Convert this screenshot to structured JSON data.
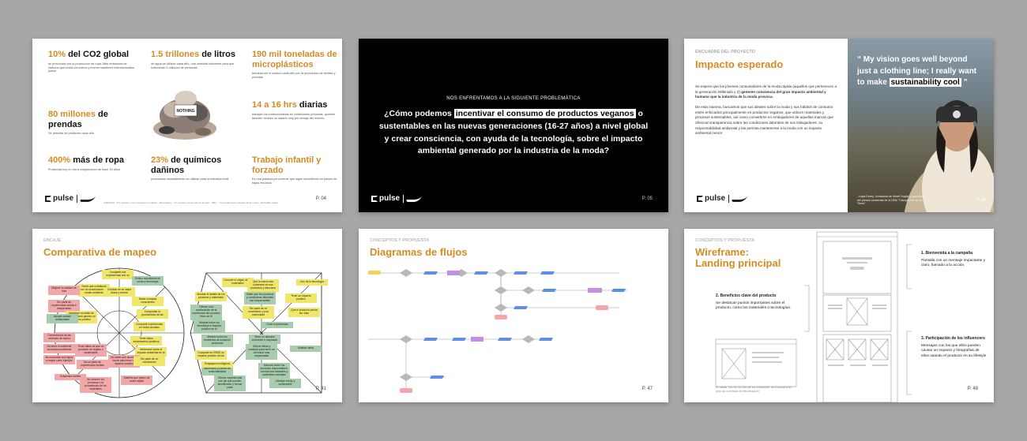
{
  "slide1": {
    "stats": [
      {
        "hl": "10%",
        "rest": " del CO2 global",
        "desc": "se provocado por la producción de ropa. Más emisiones de carbono que todos los vuelos y envíos marítimos internacionales juntos"
      },
      {
        "hl": "1.5 trillones",
        "rest": " de litros",
        "desc": "de agua se utilizan cada año, una cantidad suficiente para que sobrevivan 5 millones de personas"
      },
      {
        "hl": "190 mil toneladas de microplásticos",
        "rest": "",
        "desc": "terminan en el océano cada año por la producción de textiles y prendas"
      },
      {
        "hl": "80 millones",
        "rest": " de prendas",
        "desc": "Se prendas se producen cada año"
      },
      {
        "hl": "14 a 16 hrs",
        "rest": " diarias",
        "desc": "trabajan los confeccionistas en condiciones precarias, quienes también reciben un salario muy por debajo del mínimo"
      },
      {
        "hl": "400%",
        "rest": " más de ropa",
        "desc": "Producida hoy en día a comparación de hace 20 años"
      },
      {
        "hl": "23%",
        "rest": " de químicos dañinos",
        "desc": "producidos mundialmente se utilizan para la industria textil"
      },
      {
        "hl": "Trabajo infantil y forzado",
        "rest": "",
        "desc": "Es una práctica percurrente que sigue sucediendo en países de bajos recursos"
      }
    ],
    "sources": "FUENTES: \"The Fashion, Inc's contrast is on fatter\" - Bloomberg · \"Un vestido cuesta más de la vida\" - BBC · \"Cómo ahorra la industria de la moda\" - Bolsa/Ms. Nette",
    "page": "P. 04",
    "brand": "pulse"
  },
  "slide2": {
    "kicker": "NOS ENFRENTAMOS A LA SIGUIENTE PROBLEMÁTICA",
    "q_a": "¿Cómo podemos ",
    "q_hl": "incentivar el consumo de productos veganos",
    "q_b": " o sustentables en las nuevas generaciones (16-27 años) a nivel global y crear consciencia, con ayuda de la tecnología, sobre el impacto ambiental generado por la industria de la moda?",
    "page": "P. 05",
    "brand": "pulse"
  },
  "slide3": {
    "kicker": "ENCUADRE DEL PROYECTO",
    "title": "Impacto esperado",
    "p1a": "Se espera que los jóvenes consumidores de la moda rápida (aquellos que pertenecen a la generación Millenials y Z) ",
    "p1b": "generen conciencia del gran impacto ambiental y humano que la industria de la moda provoca.",
    "p2": "De esta manera, buscamos que sus ideales sobre la moda y sus hábitos de consumo estén enfocados principalmente en productos veganos, que utilicen materiales y procesos sustentables, así como convertirse en embajadores de aquellas marcas que ofrezcan transparencia sobre las condiciones laborales de sus trabajadores, su responsabilidad ambiental y las permita mantenerse a la moda con un impacto ambiental menor.",
    "quote_a": "“ My vision goes well beyond just a clothing line; I really want to make ",
    "quote_hl": "sustainability cool",
    "quote_b": " ”",
    "caption": "- Kaya Dorey, fundadora de Novel Supply y ganadora del premio ambiental de la ONU \"Campeones de la Tierra\"",
    "page": "P. 06",
    "brand": "pulse"
  },
  "slide4": {
    "kicker": "ENCAJE",
    "title": "Comparativa de mapeo",
    "left_notes": [
      {
        "t": "Compartir sus experiencias con su",
        "c": "y"
      },
      {
        "t": "Sentir que contribuye con la conservación del medio ambiente",
        "c": "y"
      },
      {
        "t": "Exhibir actualizado en moda y tecnología",
        "c": "g"
      },
      {
        "t": "Cuidado de su salud física y mental",
        "c": "y"
      },
      {
        "t": "Mejorar su calidad de vida",
        "c": "r"
      },
      {
        "t": "Ser parte de experiencias únicas e inesperadas",
        "c": "r"
      },
      {
        "t": "Hacer compras conscientes",
        "c": "y"
      },
      {
        "t": "Mantener su estilo de vida mientras genera un impacto positivo",
        "c": "y"
      },
      {
        "t": "Comprobar la procedencia de las",
        "c": "y"
      },
      {
        "t": "Apoyar causas ambientales",
        "c": "g"
      },
      {
        "t": "Compartir experiencias en redes sociales",
        "c": "y"
      },
      {
        "t": "Conveniencia de las acciones de marca",
        "c": "r"
      },
      {
        "t": "Tener datos fundamentos positivos",
        "c": "y"
      },
      {
        "t": "No tener el suficiente económica suficiente",
        "c": "r"
      },
      {
        "t": "Tener datos de que un producto es vegano o sustentable",
        "c": "r"
      },
      {
        "t": "Informarse sobre el impacto ambiental de la",
        "c": "y"
      },
      {
        "t": "No encontrar una figura a seguir como ejemplo",
        "c": "r"
      },
      {
        "t": "No se parte de experiencias inútiles",
        "c": "r"
      },
      {
        "t": "No saber qué acciones tomar para tener un impacto positivo",
        "c": "r"
      },
      {
        "t": "Ser parte de un movimiento",
        "c": "y"
      },
      {
        "t": "Existencia inútiles",
        "c": "r"
      },
      {
        "t": "No conocer los procesos o la procedencia de los materiales",
        "c": "r"
      },
      {
        "t": "Diseños que pasen de moda rápido",
        "c": "r"
      }
    ],
    "right_notes": [
      {
        "t": "Conocer el origen de los materiales",
        "c": "y"
      },
      {
        "t": "Que la marca sea coherente en sus productos y discursos",
        "c": "y"
      },
      {
        "t": "Uso de la tecnología",
        "c": "y"
      },
      {
        "t": "Mostrar el detalle de los procesos y materiales",
        "c": "y"
      },
      {
        "t": "Saber que los procesos y condiciones laborales son responsables",
        "c": "g"
      },
      {
        "t": "Tener un impacto positivo",
        "c": "y"
      },
      {
        "t": "Ofrecer una continuación de la experiencia del producto físico en el",
        "c": "g"
      },
      {
        "t": "Ser parte de un movimiento y una comunidad",
        "c": "y"
      },
      {
        "t": "Que el producto pueda ser visto",
        "c": "y"
      },
      {
        "t": "Crear experiencias",
        "c": "g"
      },
      {
        "t": "Mostrar todos los beneficios el impacto positivo en el",
        "c": "g"
      },
      {
        "t": "Mostrar todos los beneficios de consumir productos",
        "c": "g"
      },
      {
        "t": "Tener un discurso coherente e inspirador",
        "c": "g"
      },
      {
        "t": "Ofrecer ideas y consejos para tener un consumo más responsable",
        "c": "g"
      },
      {
        "t": "Mostrar cifras",
        "c": "g"
      },
      {
        "t": "Compartir en RRSS su impacto positivo de las",
        "c": "y"
      },
      {
        "t": "Colaborar con influencers y líderes de sustentabilidad",
        "c": "g"
      },
      {
        "t": "Informar sobre los procesos responsables, condiciones laborales y materiales naturales",
        "c": "g"
      },
      {
        "t": "Empaques ecológicos",
        "c": "y"
      },
      {
        "t": "Ofrecer experiencias con las que pueden identificarse y formar parte",
        "c": "g"
      },
      {
        "t": "Lifestyle trendy y sustentable",
        "c": "g"
      }
    ],
    "page": "P. 41"
  },
  "slide5": {
    "kicker": "CONCEPTOS Y PROPUESTA",
    "title": "Diagramas de flujos",
    "page": "P. 47"
  },
  "slide6": {
    "kicker": "CONCEPTOS Y PROPUESTA",
    "title": "Wireframe: Landing principal",
    "items": [
      {
        "t": "1. Bienvenida a la campaña",
        "d": "Pantalla con un mensaje impactante y claro, llamado a la acción."
      },
      {
        "t": "2. Beneficios clave del producto",
        "d": "Se destacan puntos importantes sobre el producto, como los materiales o tecnologías."
      },
      {
        "t": "3. Participación de los influencers",
        "d": "Mensajes con los que ellos pueden causar un impacto y fotografías de ellos usando el producto en su lifestyle"
      }
    ],
    "caption": "Al hacer clic en la foto de un influencer se mostrará un pop up con toda la información",
    "page": "P. 48"
  }
}
